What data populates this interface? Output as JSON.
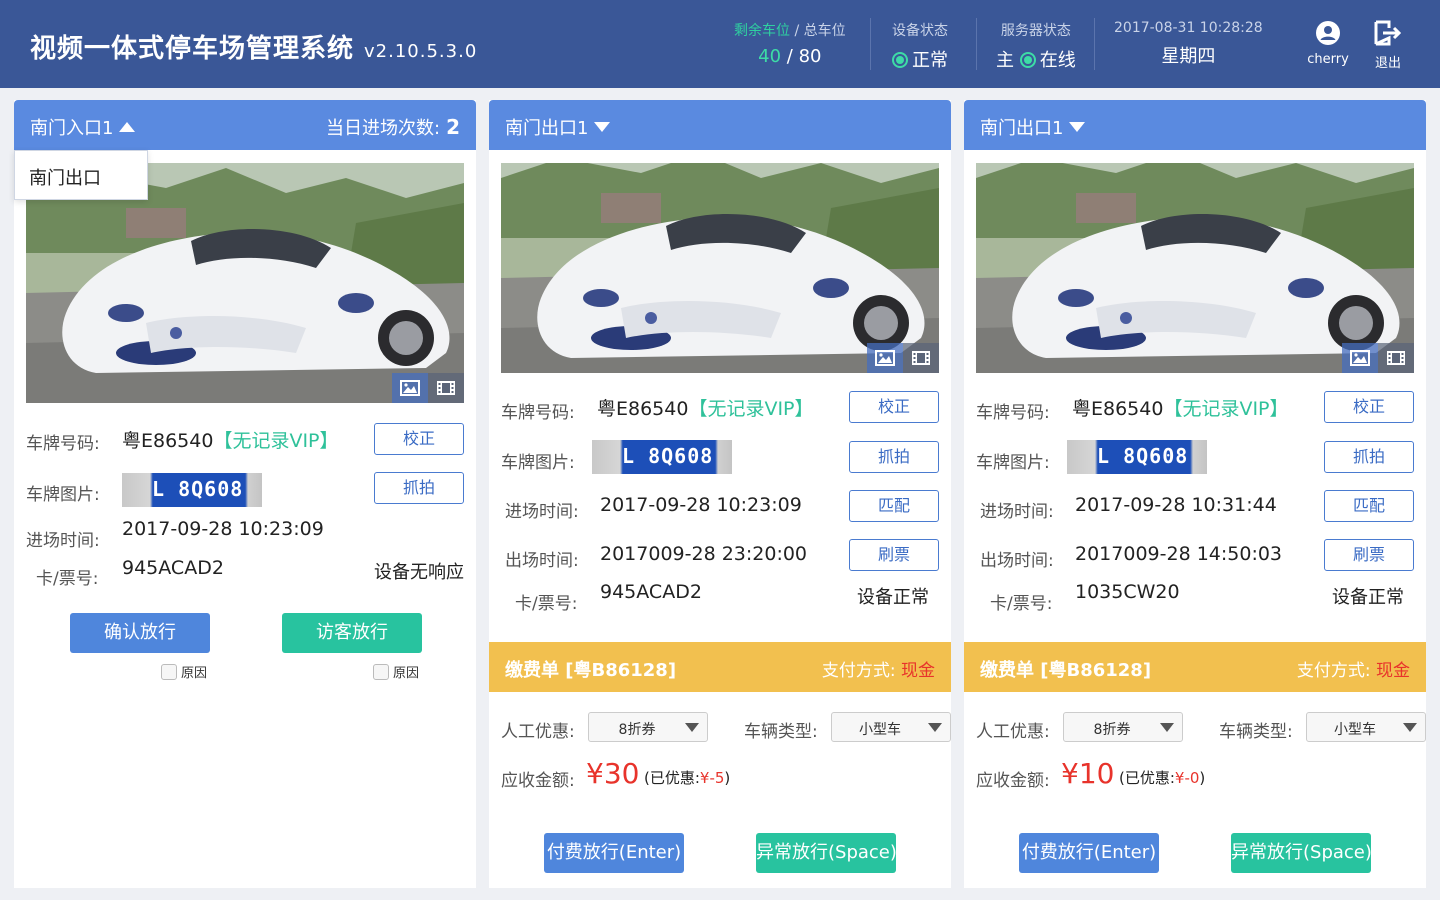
{
  "header": {
    "title": "视频一体式停车场管理系统",
    "version": "v2.10.5.3.0",
    "spaces": {
      "label_free": "剩余车位",
      "label_sep": " / ",
      "label_total": "总车位",
      "free": "40",
      "sep": " / ",
      "total": "80"
    },
    "device": {
      "label": "设备状态",
      "value": "正常"
    },
    "service": {
      "label": "服务器状态",
      "prefix": "主",
      "value": "在线"
    },
    "datetime": {
      "date": "2017-08-31 10:28:28",
      "weekday": "星期四"
    },
    "user": {
      "name": "cherry",
      "icon": "user-icon"
    },
    "logout": {
      "label": "退出",
      "icon": "logout-icon"
    }
  },
  "labels": {
    "plate_no": "车牌号码:",
    "plate_img": "车牌图片:",
    "entry_time": "进场时间:",
    "exit_time": "出场时间:",
    "ticket": "卡/票号:",
    "btn_correct": "校正",
    "btn_capture": "抓拍",
    "btn_match": "匹配",
    "btn_swipe": "刷票",
    "manual_discount": "人工优惠:",
    "vehicle_type": "车辆类型:",
    "receivable": "应收金额:",
    "pay_method": "支付方式:",
    "paid_release": "付费放行(Enter)",
    "abnormal_release": "异常放行(Space)",
    "reason": "原因"
  },
  "panels": [
    {
      "name": "南门入口1",
      "count_label": "当日进场次数:",
      "count": "2",
      "dropdown_item": "南门出口",
      "plate": "粤E86540",
      "vip": "【无记录VIP】",
      "plate_img_text": "L 8Q608",
      "entry_time": "2017-09-28 10:23:09",
      "ticket": "945ACAD2",
      "device_status": "设备无响应",
      "confirm_btn": "确认放行",
      "visitor_btn": "访客放行"
    },
    {
      "name": "南门出口1",
      "plate": "粤E86540",
      "vip": "【无记录VIP】",
      "plate_img_text": "L 8Q608",
      "entry_time": "2017-09-28 10:23:09",
      "exit_time": "2017009-28 23:20:00",
      "ticket": "945ACAD2",
      "device_status": "设备正常",
      "bill_title": "缴费单 [粤B86128]",
      "pay_method": "现金",
      "discount": "8折券",
      "vehicle_type": "小型车",
      "amount": "¥30",
      "discount_note_prefix": "(已优惠:",
      "discount_value": "¥-5",
      "discount_note_suffix": ")"
    },
    {
      "name": "南门出口1",
      "plate": "粤E86540",
      "vip": "【无记录VIP】",
      "plate_img_text": "L 8Q608",
      "entry_time": "2017-09-28 10:31:44",
      "exit_time": "2017009-28 14:50:03",
      "ticket": "1035CW20",
      "device_status": "设备正常",
      "bill_title": "缴费单 [粤B86128]",
      "pay_method": "现金",
      "discount": "8折券",
      "vehicle_type": "小型车",
      "amount": "¥10",
      "discount_note_prefix": "(已优惠:",
      "discount_value": "¥-0",
      "discount_note_suffix": ")"
    }
  ],
  "colors": {
    "header_bg": "#3a5797",
    "panel_head": "#5a8ae0",
    "bill_head": "#f2c04f",
    "accent_green": "#2fc19a",
    "accent_red": "#e8332b",
    "btn_blue": "#4f86dc",
    "btn_teal": "#28c39f"
  },
  "icons": {
    "photo": "image-icon",
    "video": "film-icon"
  }
}
